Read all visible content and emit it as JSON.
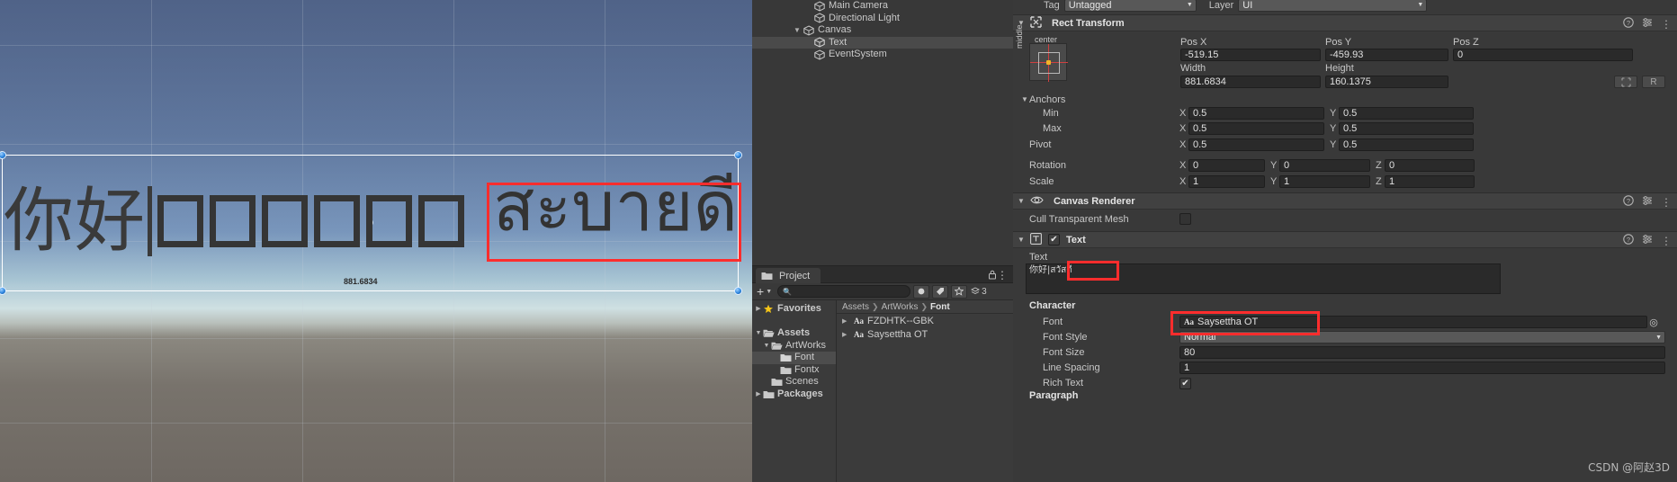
{
  "scene": {
    "text_content_cjk": "你好",
    "text_content_thai": "สะบายดี",
    "width_label": "881.6834",
    "tofu_count": 6
  },
  "hierarchy": {
    "items": [
      {
        "label": "Main Camera",
        "indent": 1,
        "foldout": "",
        "selected": false
      },
      {
        "label": "Directional Light",
        "indent": 1,
        "foldout": "",
        "selected": false
      },
      {
        "label": "Canvas",
        "indent": 1,
        "foldout": "▼",
        "selected": false
      },
      {
        "label": "Text",
        "indent": 2,
        "foldout": "",
        "selected": true
      },
      {
        "label": "EventSystem",
        "indent": 1,
        "foldout": "",
        "selected": false
      }
    ]
  },
  "project": {
    "tab_label": "Project",
    "search_placeholder": "",
    "search_value": "",
    "add_label": "+",
    "count_badge": "3",
    "tree": [
      {
        "label": "Favorites",
        "indent": 0,
        "arrow": "▶",
        "icon": "star-icon",
        "selected": false
      },
      {
        "label": "",
        "indent": 0,
        "arrow": "",
        "icon": "",
        "selected": false
      },
      {
        "label": "Assets",
        "indent": 0,
        "arrow": "▼",
        "icon": "folder-icon",
        "selected": false
      },
      {
        "label": "ArtWorks",
        "indent": 1,
        "arrow": "▼",
        "icon": "folder-icon",
        "selected": false
      },
      {
        "label": "Font",
        "indent": 2,
        "arrow": "",
        "icon": "folder-icon",
        "selected": true
      },
      {
        "label": "Fontx",
        "indent": 2,
        "arrow": "",
        "icon": "folder-icon",
        "selected": false
      },
      {
        "label": "Scenes",
        "indent": 1,
        "arrow": "",
        "icon": "folder-icon",
        "selected": false
      },
      {
        "label": "Packages",
        "indent": 0,
        "arrow": "▶",
        "icon": "folder-icon",
        "selected": false
      }
    ],
    "breadcrumb": [
      "Assets",
      "ArtWorks",
      "Font"
    ],
    "assets": [
      {
        "label": "FZDHTK--GBK",
        "icon": "Aa"
      },
      {
        "label": "Saysettha OT",
        "icon": "Aa"
      }
    ]
  },
  "inspector": {
    "tag_label": "Tag",
    "tag_value": "Untagged",
    "layer_label": "Layer",
    "layer_value": "UI",
    "rect_transform": {
      "title": "Rect Transform",
      "anchor_preset_h": "center",
      "anchor_preset_v": "middle",
      "pos_x_label": "Pos X",
      "pos_y_label": "Pos Y",
      "pos_z_label": "Pos Z",
      "pos_x": "-519.15",
      "pos_y": "-459.93",
      "pos_z": "0",
      "width_label": "Width",
      "height_label": "Height",
      "width": "881.6834",
      "height": "160.1375",
      "blueprint_btn": "",
      "raw_btn": "R",
      "anchors_label": "Anchors",
      "min_label": "Min",
      "max_label": "Max",
      "pivot_label": "Pivot",
      "min_x": "0.5",
      "min_y": "0.5",
      "max_x": "0.5",
      "max_y": "0.5",
      "pivot_x": "0.5",
      "pivot_y": "0.5",
      "rotation_label": "Rotation",
      "rot_x": "0",
      "rot_y": "0",
      "rot_z": "0",
      "scale_label": "Scale",
      "scale_x": "1",
      "scale_y": "1",
      "scale_z": "1"
    },
    "canvas_renderer": {
      "title": "Canvas Renderer",
      "cull_label": "Cull Transparent Mesh",
      "cull_checked": false
    },
    "text_component": {
      "title": "Text",
      "enabled": true,
      "text_label": "Text",
      "text_value": "你好|สวัสดี",
      "character_label": "Character",
      "font_label": "Font",
      "font_value": "Saysettha OT",
      "font_icon": "Aa",
      "font_style_label": "Font Style",
      "font_style_value": "Normal",
      "font_size_label": "Font Size",
      "font_size_value": "80",
      "line_spacing_label": "Line Spacing",
      "line_spacing_value": "1",
      "rich_text_label": "Rich Text",
      "rich_text_checked": true,
      "paragraph_label": "Paragraph"
    }
  },
  "watermark": "CSDN @阿赵3D",
  "colors": {
    "accent_red": "#ff2d2d",
    "panel_bg": "#393939",
    "header_bg": "#414141",
    "field_bg": "#2a2a2a",
    "selection": "#4a4a4a",
    "star_yellow": "#f5c518"
  }
}
